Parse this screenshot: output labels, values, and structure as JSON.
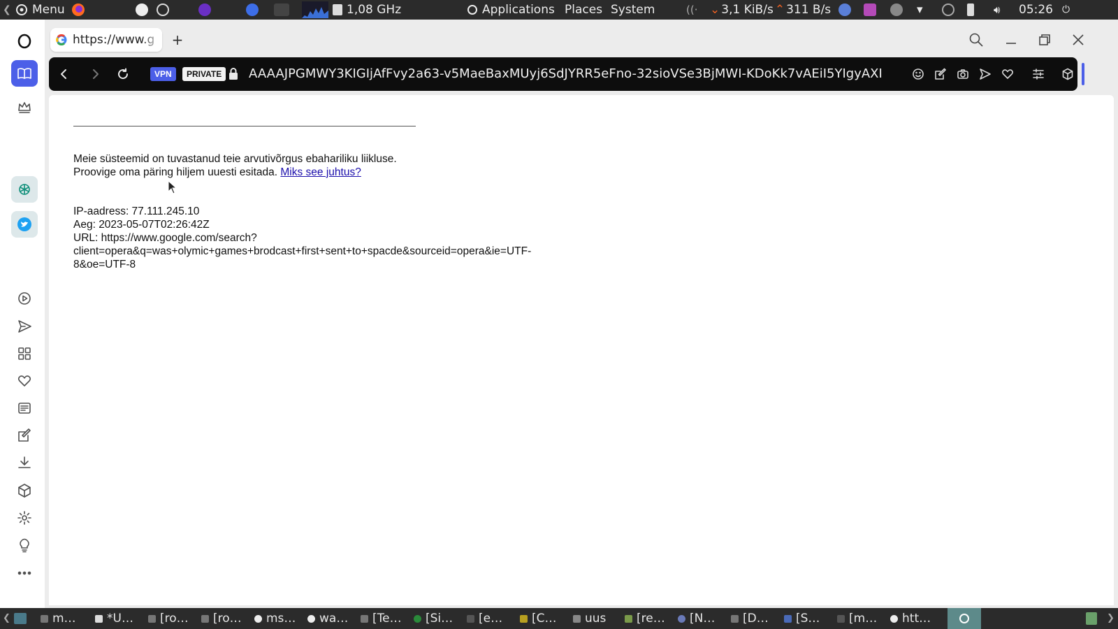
{
  "top_panel": {
    "menu_label": "Menu",
    "cpu_freq": "1,08 GHz",
    "applications_label": "Applications",
    "places_label": "Places",
    "system_label": "System",
    "net_down": "3,1 KiB/s",
    "net_up": "311 B/s",
    "clock": "05:26"
  },
  "browser": {
    "tab_title": "https://www.g",
    "address": {
      "vpn_label": "VPN",
      "private_label": "PRIVATE",
      "url": "AAAAJPGMWY3KIGIjAfFvy2a63-v5MaeBaxMUyj6SdJYRR5eFno-32sioVSe3BjMWI-KDoKk7vAEiI5YIgyAXI"
    }
  },
  "page": {
    "line1": "Meie süsteemid on tuvastanud teie arvutivõrgus ebahariliku liikluse.",
    "line2": "Proovige oma päring hiljem uuesti esitada.",
    "link": "Miks see juhtus?",
    "ip": "IP-aadress: 77.111.245.10",
    "time": "Aeg: 2023-05-07T02:26:42Z",
    "url_label": "URL: https://www.google.com/search?",
    "url_cont1": "client=opera&q=was+olymic+games+brodcast+first+sent+to+spacde&sourceid=opera&ie=UTF-",
    "url_cont2": "8&oe=UTF-8"
  },
  "taskbar": {
    "items": [
      "m…",
      "*U…",
      "[ro…",
      "[ro…",
      "ms…",
      "wa…",
      "[Te…",
      "[Si…",
      "[e…",
      "[C…",
      "uus",
      "[re…",
      "[N…",
      "[D…",
      "[S…",
      "[m…",
      "htt…"
    ]
  },
  "colors": {
    "accent": "#4c5fe8",
    "link": "#1a0dab",
    "panel": "#2b2b2b"
  }
}
